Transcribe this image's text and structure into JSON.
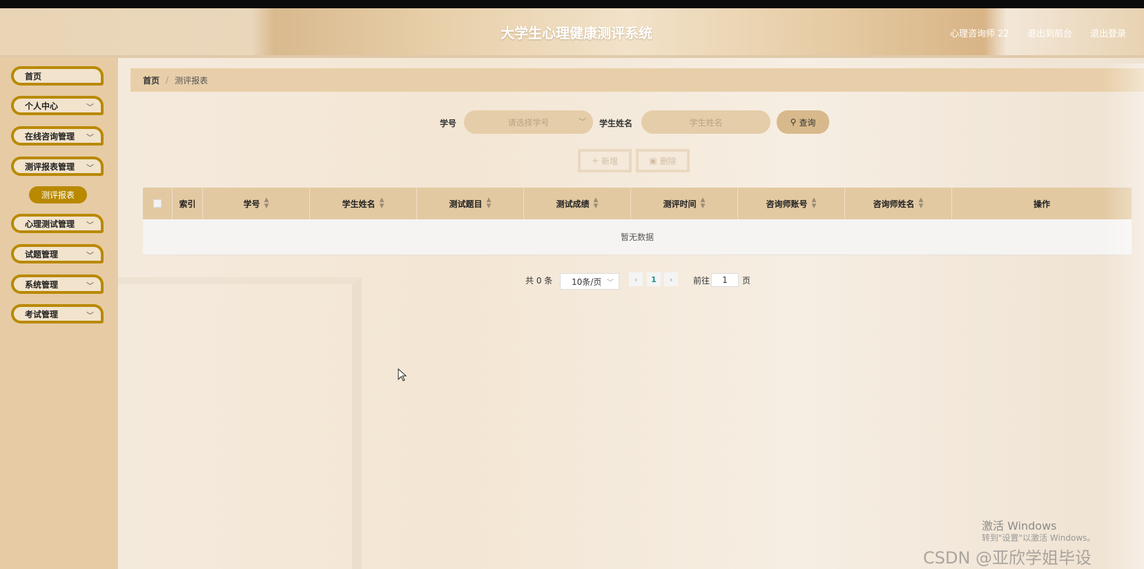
{
  "header": {
    "title": "大学生心理健康测评系统",
    "user": "心理咨询师 22",
    "exit_front": "退出到前台",
    "logout": "退出登录"
  },
  "sidebar": {
    "items": [
      {
        "label": "首页",
        "has_chevron": false
      },
      {
        "label": "个人中心",
        "has_chevron": true
      },
      {
        "label": "在线咨询管理",
        "has_chevron": true
      },
      {
        "label": "测评报表管理",
        "has_chevron": true,
        "expanded": true
      },
      {
        "label": "心理测试管理",
        "has_chevron": true
      },
      {
        "label": "试题管理",
        "has_chevron": true
      },
      {
        "label": "系统管理",
        "has_chevron": true
      },
      {
        "label": "考试管理",
        "has_chevron": true
      }
    ],
    "active_sub": "测评报表"
  },
  "breadcrumb": {
    "home": "首页",
    "current": "测评报表"
  },
  "search": {
    "xuehao_label": "学号",
    "xuehao_placeholder": "请选择学号",
    "name_label": "学生姓名",
    "name_placeholder": "学生姓名",
    "query_button": "查询"
  },
  "actions": {
    "add": "新增",
    "delete": "删除"
  },
  "table": {
    "columns": [
      "索引",
      "学号",
      "学生姓名",
      "测试题目",
      "测试成绩",
      "测评时间",
      "咨询师账号",
      "咨询师姓名",
      "操作"
    ],
    "empty_text": "暂无数据"
  },
  "pagination": {
    "total": "共 0 条",
    "page_size": "10条/页",
    "current_page": "1",
    "goto_label": "前往",
    "goto_value": "1",
    "page_unit": "页"
  },
  "overlay": {
    "activate_title": "激活 Windows",
    "activate_sub": "转到\"设置\"以激活 Windows。",
    "csdn": "CSDN @亚欣学姐毕设"
  },
  "colors": {
    "accent": "#b98900",
    "sidebar_bg": "#e6cba5",
    "table_header": "#e3c9a2"
  }
}
